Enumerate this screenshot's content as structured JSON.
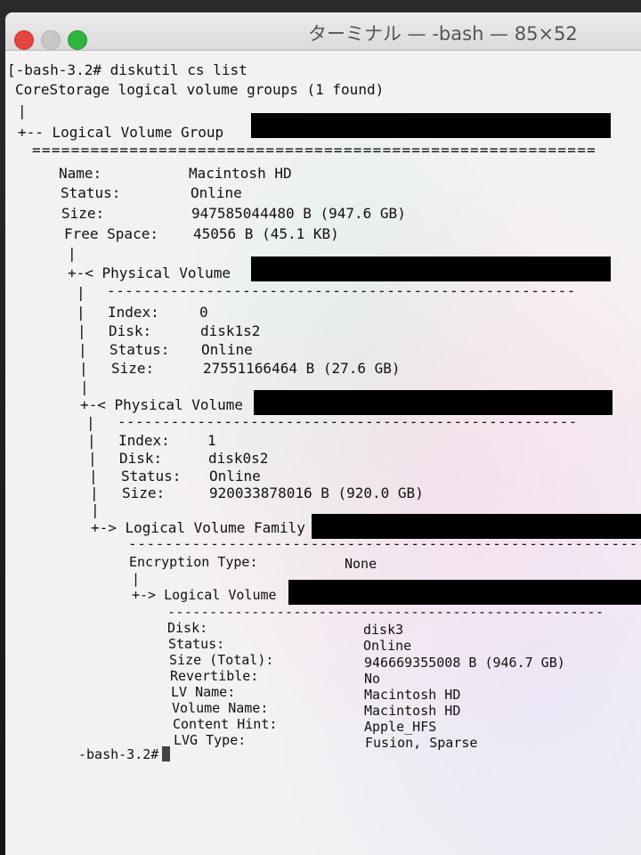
{
  "window": {
    "title": "ターミナル — -bash — 85×52"
  },
  "lines": {
    "command": "[-bash-3.2# diskutil cs list",
    "found": "CoreStorage logical volume groups (1 found)",
    "bar1": "|",
    "lvg_header": "+-- Logical Volume Group",
    "lvg_rule": "==========================================================",
    "lvg_name_label": "Name:",
    "lvg_name_value": "Macintosh HD",
    "lvg_status_label": "Status:",
    "lvg_status_value": "Online",
    "lvg_size_label": "Size:",
    "lvg_size_value": "947585044480 B (947.6 GB)",
    "lvg_free_label": "Free Space:",
    "lvg_free_value": "45056 B (45.1 KB)",
    "bar2": "|",
    "pv1_header": "+-< Physical Volume",
    "pv1_rule": "----------------------------------------------------",
    "pv1_index_label": "Index:",
    "pv1_index_value": "0",
    "pv1_disk_label": "Disk:",
    "pv1_disk_value": "disk1s2",
    "pv1_status_label": "Status:",
    "pv1_status_value": "Online",
    "pv1_size_label": "Size:",
    "pv1_size_value": "27551166464 B (27.6 GB)",
    "pv2_header": "+-< Physical Volume",
    "pv2_rule": "----------------------------------------------------",
    "pv2_index_label": "Index:",
    "pv2_index_value": "1",
    "pv2_disk_label": "Disk:",
    "pv2_disk_value": "disk0s2",
    "pv2_status_label": "Status:",
    "pv2_status_value": "Online",
    "pv2_size_label": "Size:",
    "pv2_size_value": "920033878016 B (920.0 GB)",
    "lvf_header": "+-> Logical Volume Family",
    "lvf_rule": "----------------------------------------------------------",
    "lvf_enc_label": "Encryption Type:",
    "lvf_enc_value": "None",
    "bar3": "|",
    "lv_header": "+-> Logical Volume",
    "lv_rule": "----------------------------------------------------",
    "lv_disk_label": "Disk:",
    "lv_disk_value": "disk3",
    "lv_status_label": "Status:",
    "lv_status_value": "Online",
    "lv_size_label": "Size (Total):",
    "lv_size_value": "946669355008 B (946.7 GB)",
    "lv_rev_label": "Revertible:",
    "lv_rev_value": "No",
    "lv_lvname_label": "LV Name:",
    "lv_lvname_value": "Macintosh HD",
    "lv_volname_label": "Volume Name:",
    "lv_volname_value": "Macintosh HD",
    "lv_hint_label": "Content Hint:",
    "lv_hint_value": "Apple_HFS",
    "lv_lvg_label": "LVG Type:",
    "lv_lvg_value": "Fusion, Sparse",
    "prompt": "-bash-3.2#"
  },
  "colors": {
    "close": "#e2463f",
    "minimize": "#c9c7c6",
    "zoom": "#2fb440",
    "redaction": "#000000"
  }
}
